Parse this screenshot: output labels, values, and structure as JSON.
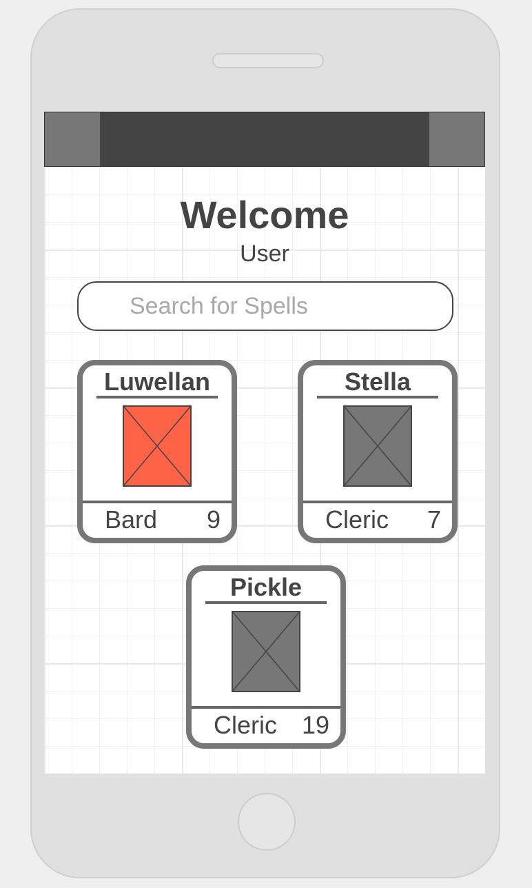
{
  "welcome": {
    "title": "Welcome",
    "subtitle": "User"
  },
  "search": {
    "placeholder": "Search for Spells"
  },
  "characters": [
    {
      "name": "Luwellan",
      "class": "Bard",
      "level": "9",
      "portrait_color": "#ff6347",
      "portrait_icon": "image-placeholder-icon"
    },
    {
      "name": "Stella",
      "class": "Cleric",
      "level": "7",
      "portrait_color": "#777777",
      "portrait_icon": "image-placeholder-icon"
    },
    {
      "name": "Pickle",
      "class": "Cleric",
      "level": "19",
      "portrait_color": "#777777",
      "portrait_icon": "image-placeholder-icon"
    }
  ],
  "colors": {
    "topbar": "#444444",
    "topbar_button": "#777777",
    "card_border": "#777777",
    "text": "#444444"
  }
}
